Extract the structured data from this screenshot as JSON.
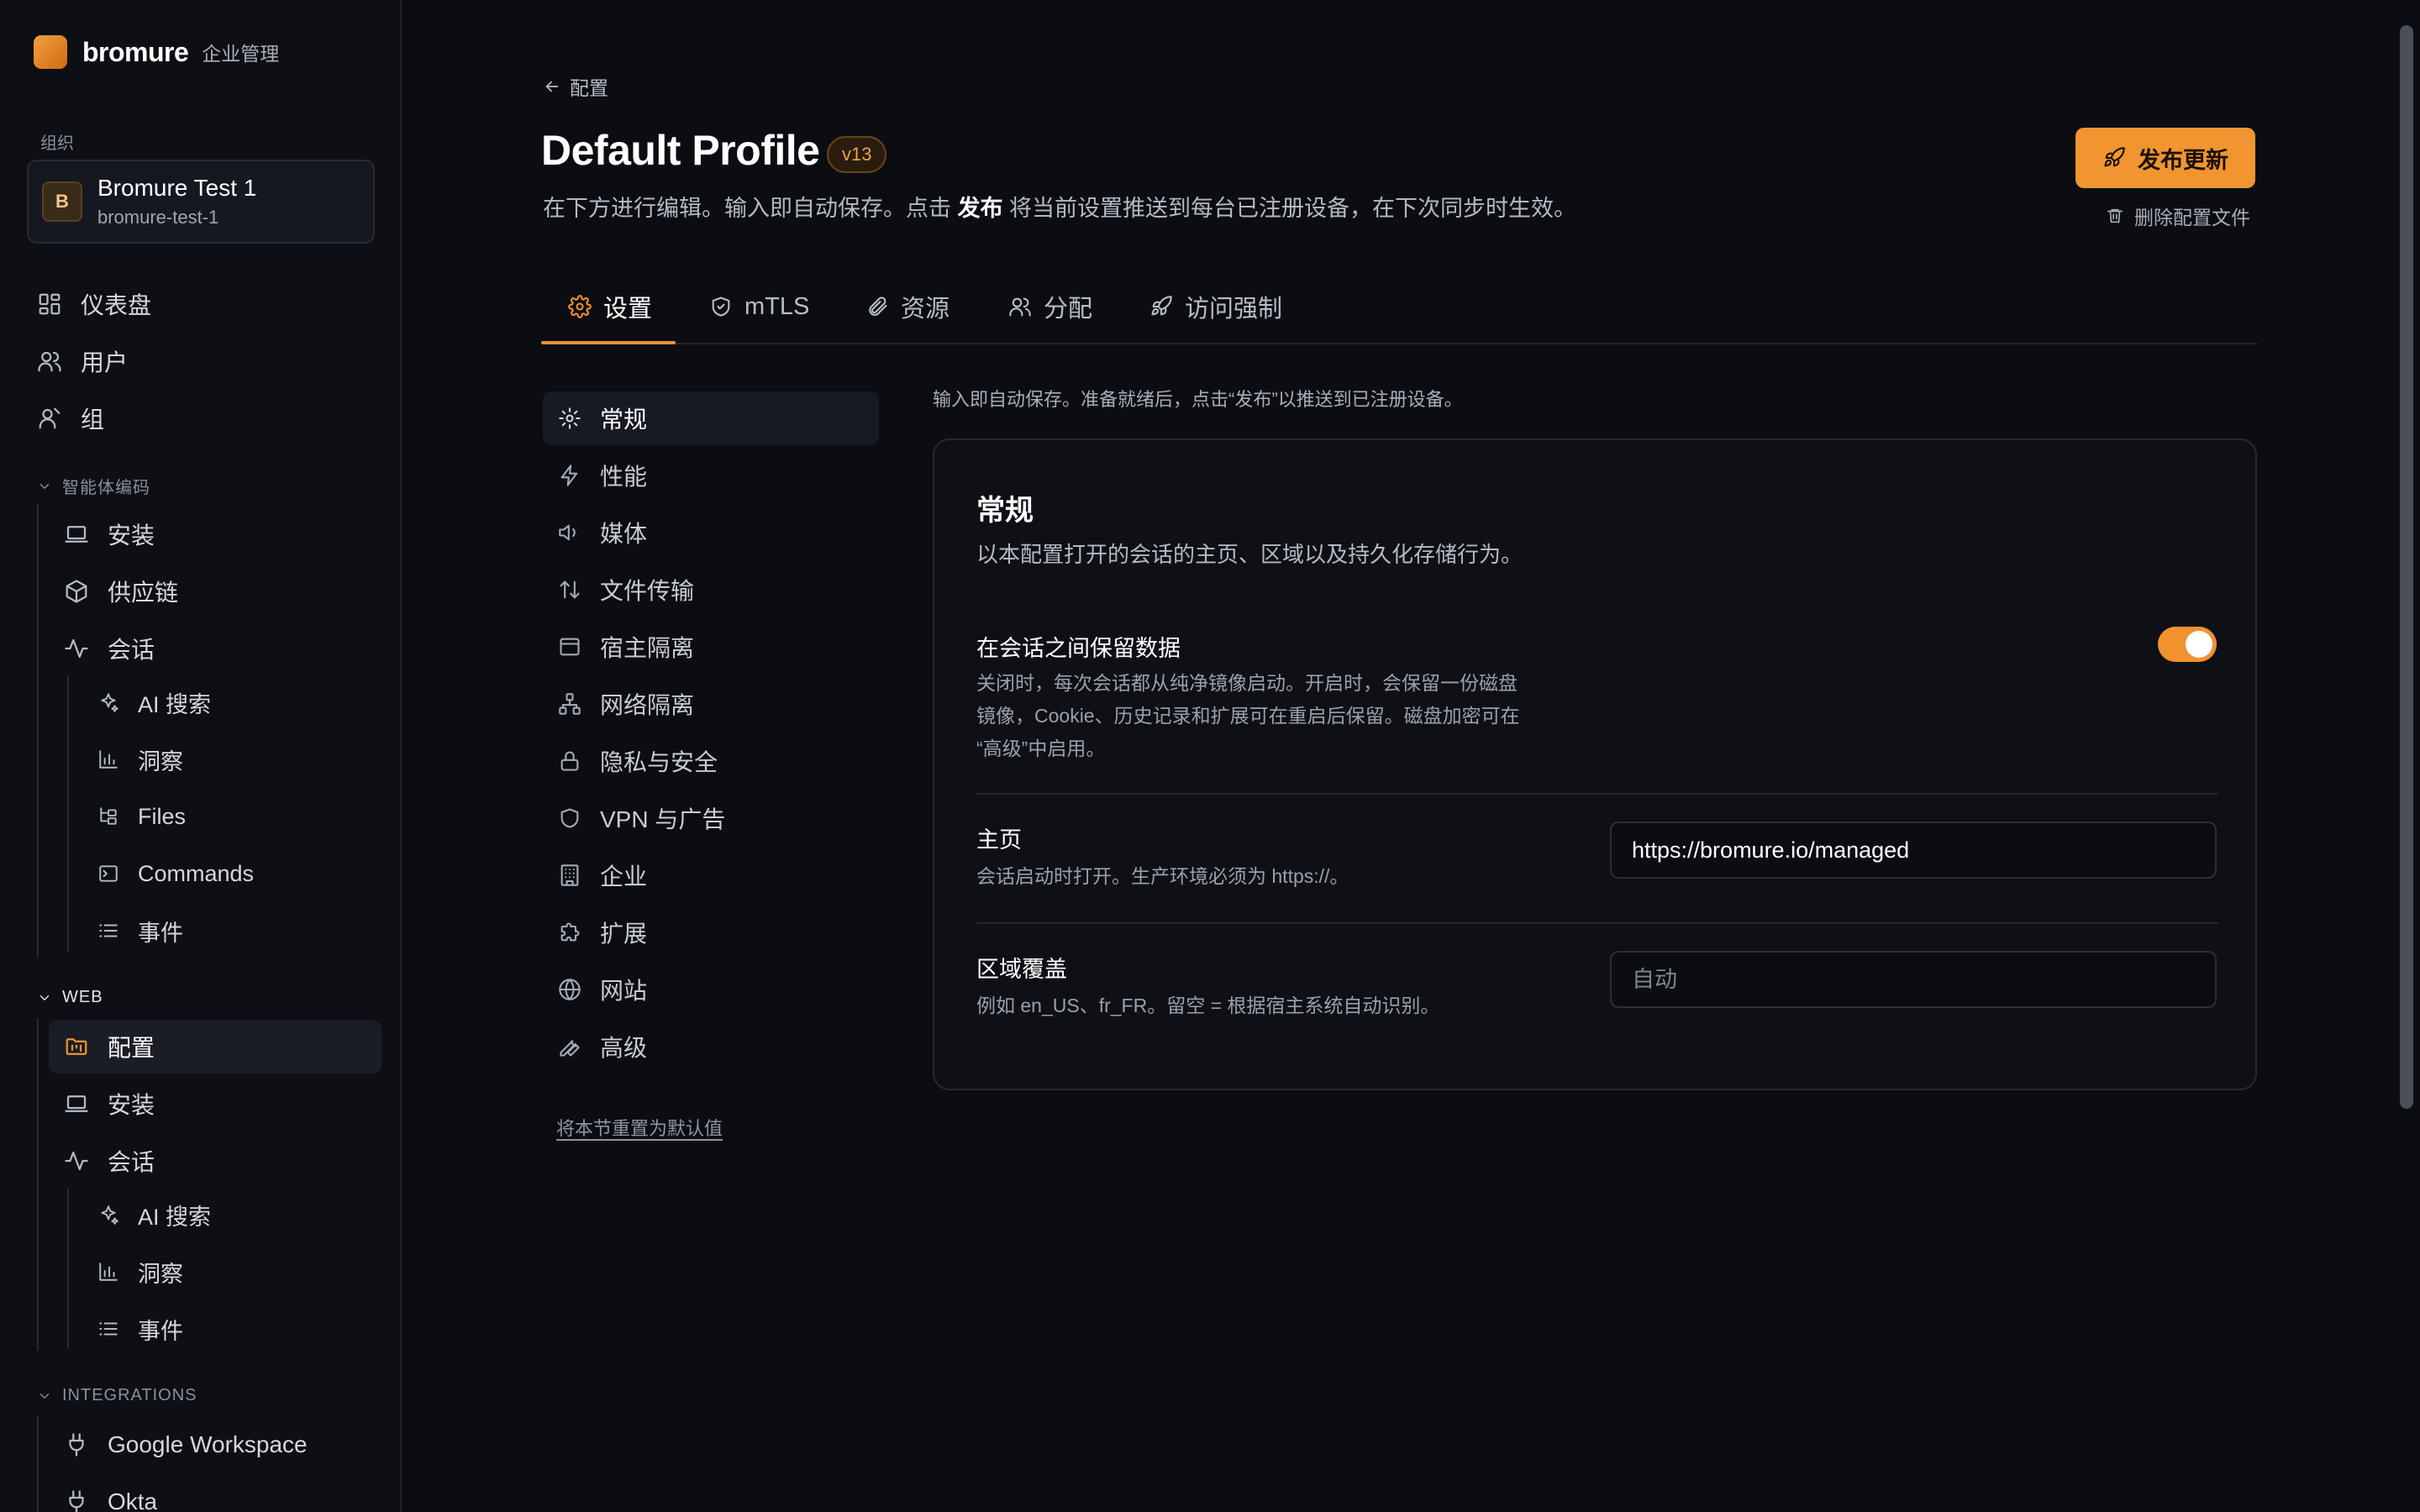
{
  "brand": {
    "name": "bromure",
    "subtitle": "企业管理"
  },
  "org": {
    "label": "组织",
    "avatar": "B",
    "name": "Bromure Test 1",
    "slug": "bromure-test-1"
  },
  "sidebar": {
    "top": [
      {
        "label": "仪表盘",
        "icon": "dashboard-icon"
      },
      {
        "label": "用户",
        "icon": "users-icon"
      },
      {
        "label": "组",
        "icon": "group-icon"
      }
    ],
    "agent_section": {
      "title": "智能体编码",
      "items": [
        {
          "label": "安装",
          "icon": "laptop-icon"
        },
        {
          "label": "供应链",
          "icon": "package-icon"
        },
        {
          "label": "会话",
          "icon": "activity-icon"
        }
      ],
      "session_children": [
        {
          "label": "AI 搜索",
          "icon": "sparkles-icon"
        },
        {
          "label": "洞察",
          "icon": "bar-chart-icon"
        },
        {
          "label": "Files",
          "icon": "folder-tree-icon"
        },
        {
          "label": "Commands",
          "icon": "terminal-icon"
        },
        {
          "label": "事件",
          "icon": "list-icon"
        }
      ]
    },
    "web_section": {
      "title": "WEB",
      "items": [
        {
          "label": "配置",
          "icon": "folder-kanban-icon"
        },
        {
          "label": "安装",
          "icon": "laptop-icon"
        },
        {
          "label": "会话",
          "icon": "activity-icon"
        }
      ],
      "session_children": [
        {
          "label": "AI 搜索",
          "icon": "sparkles-icon"
        },
        {
          "label": "洞察",
          "icon": "bar-chart-icon"
        },
        {
          "label": "事件",
          "icon": "list-icon"
        }
      ]
    },
    "integrations_section": {
      "title": "INTEGRATIONS",
      "items": [
        {
          "label": "Google Workspace",
          "icon": "plug-icon"
        },
        {
          "label": "Okta",
          "icon": "plug-icon"
        }
      ]
    }
  },
  "header": {
    "back_label": "配置",
    "title": "Default Profile",
    "version": "v13",
    "subtitle_pre": "在下方进行编辑。输入即自动保存。点击 ",
    "subtitle_bold": "发布",
    "subtitle_post": " 将当前设置推送到每台已注册设备，在下次同步时生效。",
    "publish_label": "发布更新",
    "delete_label": "删除配置文件"
  },
  "tabs": [
    {
      "label": "设置",
      "icon": "gear-icon",
      "active": true
    },
    {
      "label": "mTLS",
      "icon": "shield-check-icon"
    },
    {
      "label": "资源",
      "icon": "paperclip-icon"
    },
    {
      "label": "分配",
      "icon": "users-icon"
    },
    {
      "label": "访问强制",
      "icon": "rocket-icon"
    }
  ],
  "subnav": {
    "items": [
      {
        "label": "常规",
        "icon": "gear-icon",
        "active": true
      },
      {
        "label": "性能",
        "icon": "zap-icon"
      },
      {
        "label": "媒体",
        "icon": "volume-icon"
      },
      {
        "label": "文件传输",
        "icon": "arrow-up-down-icon"
      },
      {
        "label": "宿主隔离",
        "icon": "browser-window-icon"
      },
      {
        "label": "网络隔离",
        "icon": "network-icon"
      },
      {
        "label": "隐私与安全",
        "icon": "lock-icon"
      },
      {
        "label": "VPN 与广告",
        "icon": "shield-icon"
      },
      {
        "label": "企业",
        "icon": "building-icon"
      },
      {
        "label": "扩展",
        "icon": "puzzle-icon"
      },
      {
        "label": "网站",
        "icon": "globe-icon"
      },
      {
        "label": "高级",
        "icon": "wrench-icon"
      }
    ],
    "reset_label": "将本节重置为默认值"
  },
  "content": {
    "hint": "输入即自动保存。准备就绪后，点击“发布”以推送到已注册设备。",
    "panel_title": "常规",
    "panel_desc": "以本配置打开的会话的主页、区域以及持久化存储行为。",
    "persist": {
      "label": "在会话之间保留数据",
      "desc_line1": "关闭时，每次会话都从纯净镜像启动。开启时，会保留一份磁盘",
      "desc_line2": "镜像，Cookie、历史记录和扩展可在重启后保留。磁盘加密可在",
      "desc_line3": "“高级”中启用。",
      "enabled": true
    },
    "homepage": {
      "label": "主页",
      "desc": "会话启动时打开。生产环境必须为 https://。",
      "value": "https://bromure.io/managed"
    },
    "locale": {
      "label": "区域覆盖",
      "desc": "例如 en_US、fr_FR。留空 = 根据宿主系统自动识别。",
      "value": "",
      "placeholder": "自动"
    }
  },
  "colors": {
    "accent": "#f0922e",
    "background": "#0b0d12",
    "panel": "#0e1016"
  }
}
